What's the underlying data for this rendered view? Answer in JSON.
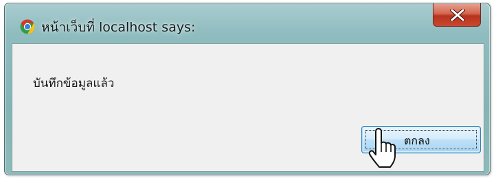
{
  "dialog": {
    "title": "หน้าเว็บที่ localhost says:",
    "message": "บันทึกข้อมูลแล้ว",
    "ok_label": "ตกลง",
    "close_label": "X",
    "icons": {
      "app": "chrome-icon",
      "close": "close-icon",
      "pointer": "hand-pointer-cursor"
    }
  },
  "colors": {
    "titlebar": "#8fbcbf",
    "content_bg": "#f0f0f0",
    "close_button": "#c9472f",
    "ok_button": "#bee0f7"
  }
}
